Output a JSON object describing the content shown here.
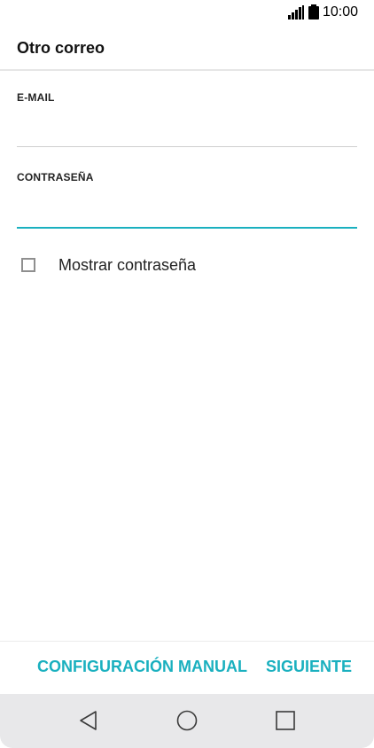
{
  "status_bar": {
    "time": "10:00",
    "icons": [
      "signal-icon",
      "battery-icon"
    ]
  },
  "header": {
    "title": "Otro correo"
  },
  "form": {
    "email_label": "E-MAIL",
    "email_value": "",
    "password_label": "CONTRASEÑA",
    "password_value": "",
    "show_password_label": "Mostrar contraseña",
    "show_password_checked": false
  },
  "actions": {
    "manual_label": "CONFIGURACIÓN MANUAL",
    "next_label": "SIGUIENTE"
  },
  "nav": {
    "icons": [
      "back-icon",
      "home-icon",
      "recents-icon"
    ]
  },
  "colors": {
    "accent": "#1ab0bf",
    "nav_background": "#e8e8ea",
    "divider": "#cfcfcf"
  }
}
